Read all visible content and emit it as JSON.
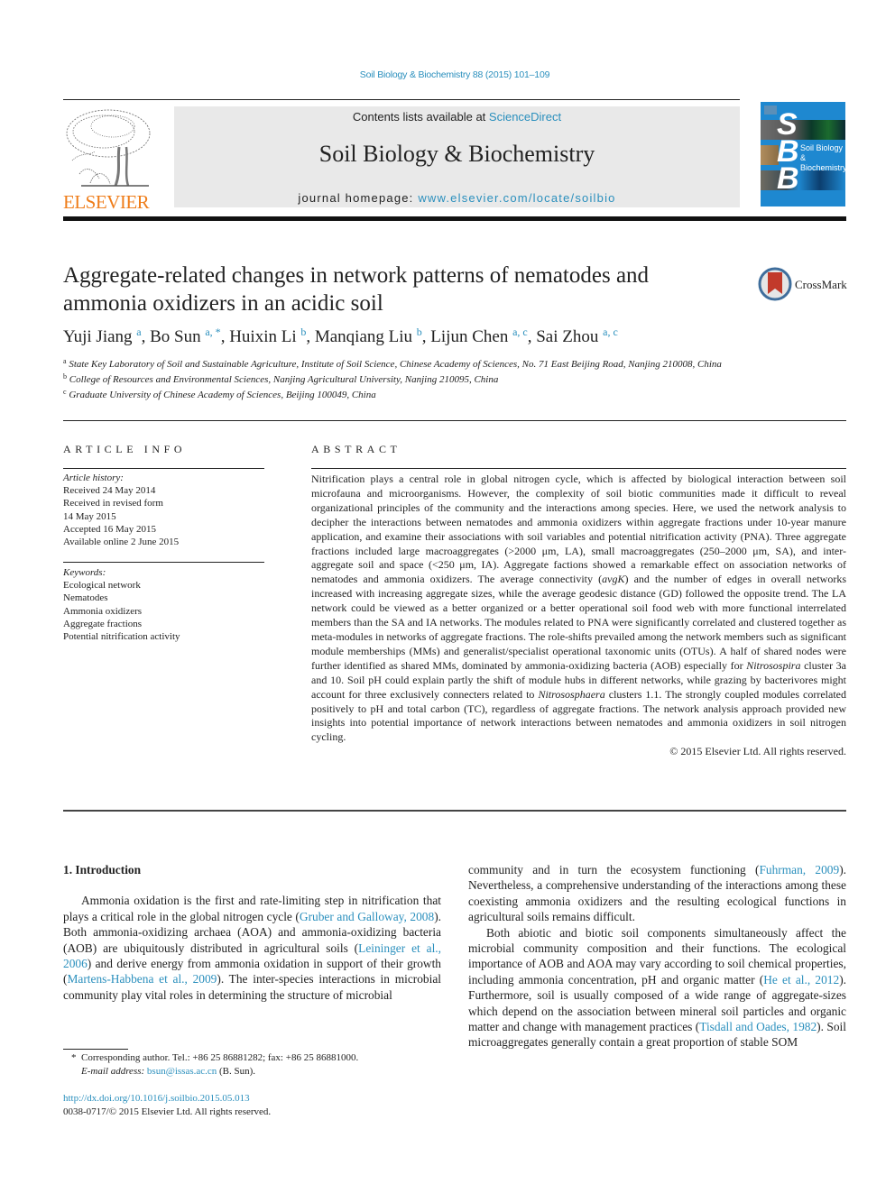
{
  "header": {
    "citation": "Soil Biology & Biochemistry 88 (2015) 101–109",
    "contents_prefix": "Contents lists available at ",
    "contents_link": "ScienceDirect",
    "journal_name": "Soil Biology & Biochemistry",
    "homepage_prefix": "journal homepage: ",
    "homepage_link": "www.elsevier.com/locate/soilbio",
    "publisher_logo_text": "ELSEVIER",
    "cover": {
      "letters": [
        "S",
        "B",
        "B"
      ],
      "title_line1": "Soil Biology &",
      "title_line2": "Biochemistry",
      "color": "#1e88d0"
    }
  },
  "article": {
    "title": "Aggregate-related changes in network patterns of nematodes and ammonia oxidizers in an acidic soil",
    "crossmark_label": "CrossMark",
    "authors": [
      {
        "name": "Yuji Jiang",
        "sup": "a"
      },
      {
        "name": "Bo Sun",
        "sup": "a, *"
      },
      {
        "name": "Huixin Li",
        "sup": "b"
      },
      {
        "name": "Manqiang Liu",
        "sup": "b"
      },
      {
        "name": "Lijun Chen",
        "sup": "a, c"
      },
      {
        "name": "Sai Zhou",
        "sup": "a, c"
      }
    ],
    "affiliations": [
      {
        "key": "a",
        "text": "State Key Laboratory of Soil and Sustainable Agriculture, Institute of Soil Science, Chinese Academy of Sciences, No. 71 East Beijing Road, Nanjing 210008, China"
      },
      {
        "key": "b",
        "text": "College of Resources and Environmental Sciences, Nanjing Agricultural University, Nanjing 210095, China"
      },
      {
        "key": "c",
        "text": "Graduate University of Chinese Academy of Sciences, Beijing 100049, China"
      }
    ]
  },
  "article_info": {
    "heading": "ARTICLE INFO",
    "history_label": "Article history:",
    "history": [
      "Received 24 May 2014",
      "Received in revised form",
      "14 May 2015",
      "Accepted 16 May 2015",
      "Available online 2 June 2015"
    ],
    "keywords_label": "Keywords:",
    "keywords": [
      "Ecological network",
      "Nematodes",
      "Ammonia oxidizers",
      "Aggregate fractions",
      "Potential nitrification activity"
    ]
  },
  "abstract": {
    "heading": "ABSTRACT",
    "p1": "Nitrification plays a central role in global nitrogen cycle, which is affected by biological interaction between soil microfauna and microorganisms. However, the complexity of soil biotic communities made it difficult to reveal organizational principles of the community and the interactions among species. Here, we used the network analysis to decipher the interactions between nematodes and ammonia oxidizers within aggregate fractions under 10-year manure application, and examine their associations with soil variables and potential nitrification activity (PNA). Three aggregate fractions included large macroaggregates (>2000 μm, LA), small macroaggregates (250–2000 μm, SA), and inter-aggregate soil and space (<250 μm, IA). Aggregate factions showed a remarkable effect on association networks of nematodes and ammonia oxidizers. The average connectivity (",
    "avgk": "avgK",
    "p2": ") and the number of edges in overall networks increased with increasing aggregate sizes, while the average geodesic distance (GD) followed the opposite trend. The LA network could be viewed as a better organized or a better operational soil food web with more functional interrelated members than the SA and IA networks. The modules related to PNA were significantly correlated and clustered together as meta-modules in networks of aggregate fractions. The role-shifts prevailed among the network members such as significant module memberships (MMs) and generalist/specialist operational taxonomic units (OTUs). A half of shared nodes were further identified as shared MMs, dominated by ammonia-oxidizing bacteria (AOB) especially for ",
    "nitrosospira": "Nitrosospira",
    "p3": " cluster 3a and 10. Soil pH could explain partly the shift of module hubs in different networks, while grazing by bacterivores might account for three exclusively connecters related to ",
    "nitrososphaera": "Nitrososphaera",
    "p4": " clusters 1.1. The strongly coupled modules correlated positively to pH and total carbon (TC), regardless of aggregate fractions. The network analysis approach provided new insights into potential importance of network interactions between nematodes and ammonia oxidizers in soil nitrogen cycling.",
    "copyright": "© 2015 Elsevier Ltd. All rights reserved."
  },
  "body": {
    "section_heading": "1.  Introduction",
    "left": {
      "t1": "Ammonia oxidation is the first and rate-limiting step in nitrification that plays a critical role in the global nitrogen cycle (",
      "c1": "Gruber and Galloway, 2008",
      "t2": "). Both ammonia-oxidizing archaea (AOA) and ammonia-oxidizing bacteria (AOB) are ubiquitously distributed in agricultural soils (",
      "c2": "Leininger et al., 2006",
      "t3": ") and derive energy from ammonia oxidation in support of their growth (",
      "c3": "Martens-Habbena et al., 2009",
      "t4": "). The inter-species interactions in microbial community play vital roles in determining the structure of microbial"
    },
    "right": {
      "t1": "community and in turn the ecosystem functioning (",
      "c1": "Fuhrman, 2009",
      "t2": "). Nevertheless, a comprehensive understanding of the interactions among these coexisting ammonia oxidizers and the resulting ecological functions in agricultural soils remains difficult.",
      "t3": "Both abiotic and biotic soil components simultaneously affect the microbial community composition and their functions. The ecological importance of AOB and AOA may vary according to soil chemical properties, including ammonia concentration, pH and organic matter (",
      "c2": "He et al., 2012",
      "t4": "). Furthermore, soil is usually composed of a wide range of aggregate-sizes which depend on the association between mineral soil particles and organic matter and change with management practices (",
      "c3": "Tisdall and Oades, 1982",
      "t5": "). Soil microaggregates generally contain a great proportion of stable SOM"
    }
  },
  "footnote": {
    "star": "*",
    "corresponding": "Corresponding author. Tel.: +86 25 86881282; fax: +86 25 86881000.",
    "email_label": "E-mail address:",
    "email": "bsun@issas.ac.cn",
    "email_suffix": " (B. Sun).",
    "doi": "http://dx.doi.org/10.1016/j.soilbio.2015.05.013",
    "issn": "0038-0717/© 2015 Elsevier Ltd. All rights reserved."
  }
}
